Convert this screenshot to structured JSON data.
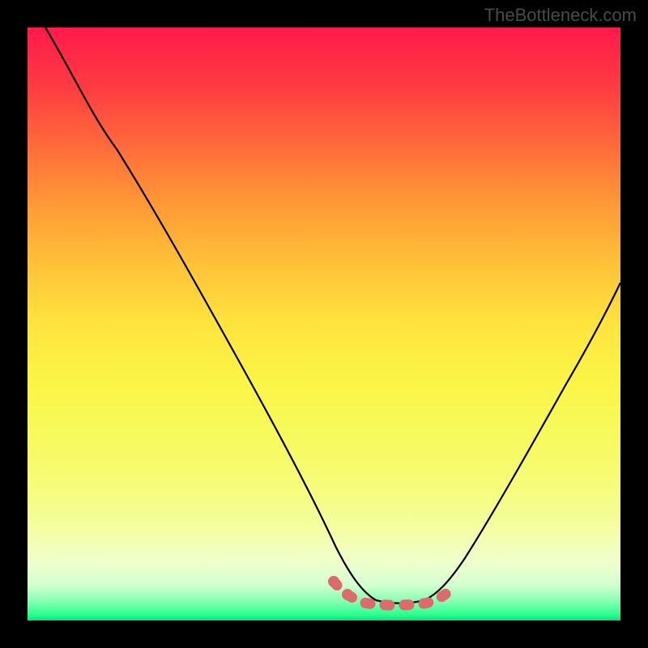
{
  "watermark": "TheBottleneck.com",
  "chart_data": {
    "type": "line",
    "title": "",
    "xlabel": "",
    "ylabel": "",
    "xlim": [
      0,
      100
    ],
    "ylim": [
      0,
      100
    ],
    "description": "Bottleneck V-curve over red-to-green vertical gradient background. Two black curve branches descend from top-left and top-right toward a flat minimum region near x≈55-68 at y≈2-4. A coral/salmon dashed overlay marks the optimal flat region.",
    "series": [
      {
        "name": "left-branch",
        "x": [
          3,
          8,
          15,
          22,
          30,
          38,
          45,
          50,
          54,
          57,
          60
        ],
        "y": [
          100,
          92,
          80,
          68,
          54,
          40,
          26,
          16,
          9,
          5,
          3
        ]
      },
      {
        "name": "right-branch",
        "x": [
          60,
          64,
          68,
          72,
          78,
          85,
          92,
          100
        ],
        "y": [
          3,
          3,
          4,
          8,
          18,
          32,
          45,
          58
        ]
      },
      {
        "name": "optimal-flat-overlay",
        "x": [
          51,
          54,
          57,
          60,
          64,
          68,
          71
        ],
        "y": [
          7,
          5,
          3.5,
          3,
          3,
          4,
          6
        ]
      }
    ],
    "colors": {
      "curve": "#000000",
      "overlay": "#e06666",
      "gradient_top": "#ff1a4a",
      "gradient_bottom": "#00e67a"
    }
  }
}
